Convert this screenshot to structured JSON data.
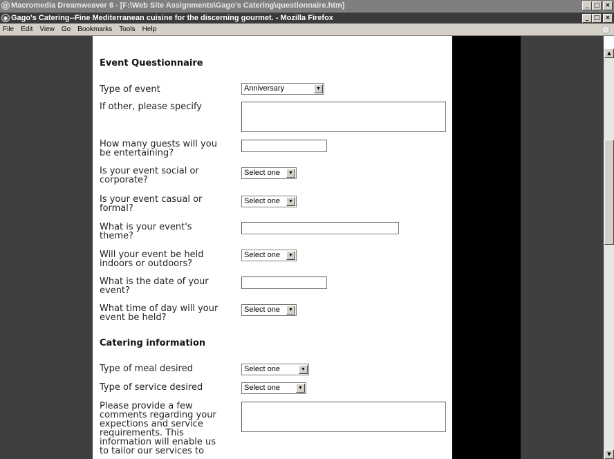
{
  "dreamweaver": {
    "title": "Macromedia Dreamweaver 8 - [F:\\Web Site Assignments\\Gago's Catering\\questionnaire.htm]"
  },
  "firefox": {
    "title": "Gago's Catering--Fine Mediterranean cuisine for the discerning gourmet. - Mozilla Firefox"
  },
  "window_buttons": {
    "minimize": "_",
    "maximize": "□",
    "close": "×"
  },
  "menu": [
    "File",
    "Edit",
    "View",
    "Go",
    "Bookmarks",
    "Tools",
    "Help"
  ],
  "scroll": {
    "up": "▲",
    "down": "▼"
  },
  "form": {
    "event_heading": "Event Questionnaire",
    "type_of_event": {
      "label": "Type of event",
      "value": "Anniversary"
    },
    "other_specify": {
      "label": "If other, please specify"
    },
    "guests": {
      "label_line1": "How many guests will you",
      "label_line2": "be entertaining?"
    },
    "social_corporate": {
      "label_line1": "Is your event social or",
      "label_line2": "corporate?",
      "value": "Select one"
    },
    "casual_formal": {
      "label_line1": "Is your event casual or",
      "label_line2": "formal?",
      "value": "Select one"
    },
    "theme": {
      "label_line1": "What is your event's",
      "label_line2": "theme?"
    },
    "indoors_outdoors": {
      "label_line1": "Will your event be held",
      "label_line2": "indoors or outdoors?",
      "value": "Select one"
    },
    "date": {
      "label_line1": "What is the date of your",
      "label_line2": "event?"
    },
    "time_of_day": {
      "label_line1": "What time of day will your",
      "label_line2": "event be held?",
      "value": "Select one"
    },
    "catering_heading": "Catering information",
    "meal_type": {
      "label": "Type of meal desired",
      "value": "Select one"
    },
    "service_type": {
      "label": "Type of service desired",
      "value": "Select one"
    },
    "comments": {
      "label_lines": [
        "Please provide a few",
        "comments regarding your",
        "expections and service",
        "requirements. This",
        "information will enable us",
        "to tailor our services to"
      ]
    }
  }
}
